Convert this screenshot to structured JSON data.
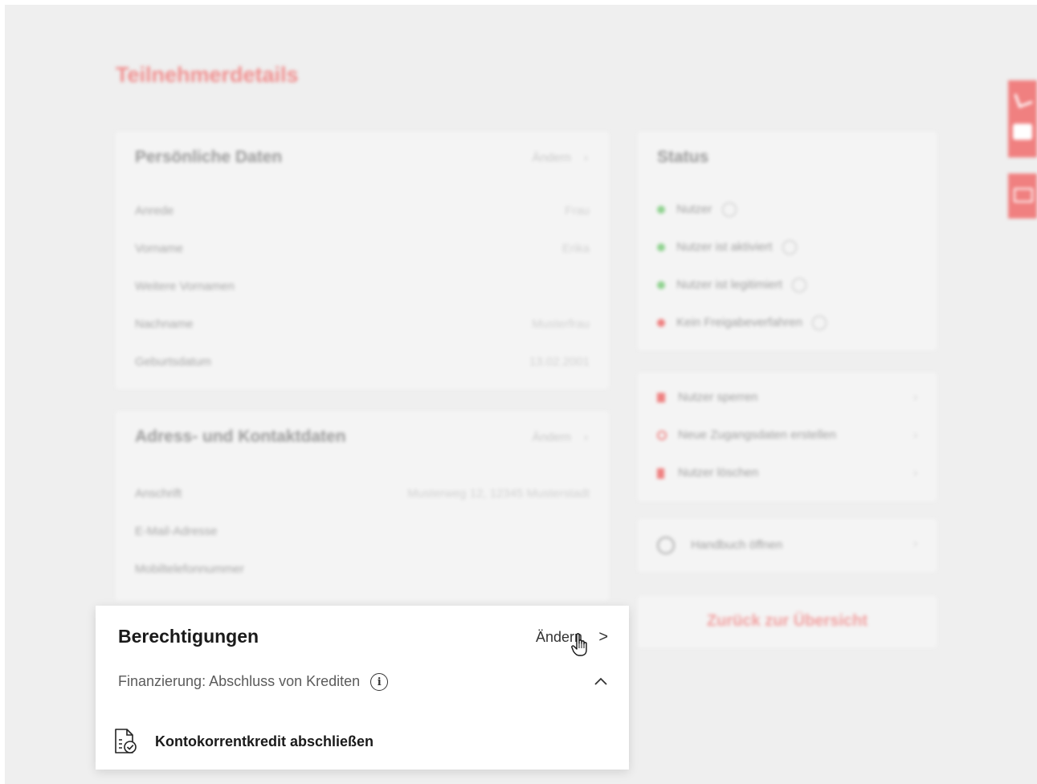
{
  "page": {
    "title": "Teilnehmerdetails"
  },
  "personal": {
    "title": "Persönliche Daten",
    "edit_label": "Ändern",
    "chevron": "›",
    "rows": [
      {
        "label": "Anrede",
        "value": "Frau"
      },
      {
        "label": "Vorname",
        "value": "Erika"
      },
      {
        "label": "Weitere Vornamen",
        "value": ""
      },
      {
        "label": "Nachname",
        "value": "Musterfrau"
      },
      {
        "label": "Geburtsdatum",
        "value": "13.02.2001"
      }
    ]
  },
  "address": {
    "title": "Adress- und Kontaktdaten",
    "edit_label": "Ändern",
    "chevron": "›",
    "rows": [
      {
        "label": "Anschrift",
        "value": "Musterweg 12, 12345 Musterstadt"
      },
      {
        "label": "E-Mail-Adresse",
        "value": ""
      },
      {
        "label": "Mobiltelefonnummer",
        "value": ""
      }
    ]
  },
  "status": {
    "title": "Status",
    "items": [
      {
        "label": "Nutzer",
        "color": "#8fd28f"
      },
      {
        "label": "Nutzer ist aktiviert",
        "color": "#8fd28f"
      },
      {
        "label": "Nutzer ist legitimiert",
        "color": "#8fd28f"
      },
      {
        "label": "Kein Freigabeverfahren",
        "color": "#ef8080"
      }
    ]
  },
  "actions": {
    "items": [
      {
        "label": "Nutzer sperren",
        "icon": "lock-icon"
      },
      {
        "label": "Neue Zugangsdaten erstellen",
        "icon": "refresh-icon"
      },
      {
        "label": "Nutzer löschen",
        "icon": "trash-icon"
      }
    ],
    "chevron": "›"
  },
  "manual": {
    "label": "Handbuch öffnen",
    "icon": "help-circle-icon",
    "chevron": "›"
  },
  "back": {
    "label": "Zurück zur Übersicht"
  },
  "permissions": {
    "title": "Berechtigungen",
    "edit_label": "Ändern",
    "chevron": ">",
    "subtitle": "Finanzierung: Abschluss von Krediten",
    "info_glyph": "i",
    "collapse_glyph": "^",
    "item_label": "Kontokorrentkredit abschließen"
  },
  "colors": {
    "accent": "#f08080",
    "title_red": "#f08e8e",
    "status_green": "#8fd28f",
    "status_red": "#ef8080"
  }
}
